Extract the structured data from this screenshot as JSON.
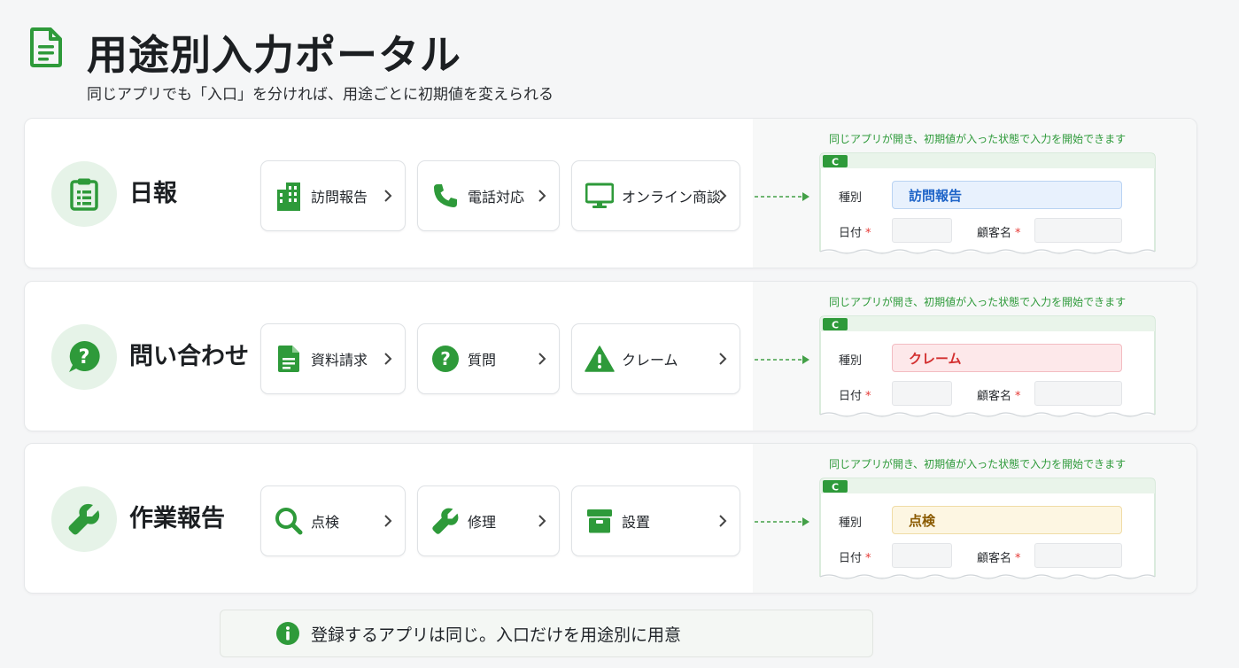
{
  "header": {
    "title": "用途別入力ポータル",
    "subtitle": "同じアプリでも「入口」を分ければ、用途ごとに初期値を変えられる",
    "icon": "document-icon"
  },
  "colors": {
    "accent_green": "#2e9a3a",
    "blue_fill": "#e8f1fd",
    "blue_text": "#1e64c8",
    "red_fill": "#fde8ea",
    "red_text": "#d32f2f",
    "yellow_fill": "#fdf6e2",
    "yellow_text": "#8a5a00"
  },
  "categories": [
    {
      "name": "日報",
      "icon": "clipboard-icon",
      "entries": [
        {
          "label": "訪問報告",
          "icon": "building-icon"
        },
        {
          "label": "電話対応",
          "icon": "phone-icon"
        },
        {
          "label": "オンライン商談",
          "icon": "monitor-icon"
        }
      ],
      "preview": {
        "caption": "同じアプリが開き、初期値が入った状態で入力を開始できます",
        "type_label": "種別",
        "type_value": "訪問報告",
        "date_label": "日付",
        "customer_label": "顧客名",
        "required_mark": "*"
      }
    },
    {
      "name": "問い合わせ",
      "icon": "question-bubble-icon",
      "entries": [
        {
          "label": "資料請求",
          "icon": "document-icon"
        },
        {
          "label": "質問",
          "icon": "question-icon"
        },
        {
          "label": "クレーム",
          "icon": "warning-icon"
        }
      ],
      "preview": {
        "caption": "同じアプリが開き、初期値が入った状態で入力を開始できます",
        "type_label": "種別",
        "type_value": "クレーム",
        "date_label": "日付",
        "customer_label": "顧客名",
        "required_mark": "*"
      }
    },
    {
      "name": "作業報告",
      "icon": "wrench-icon",
      "entries": [
        {
          "label": "点検",
          "icon": "search-icon"
        },
        {
          "label": "修理",
          "icon": "wrench-icon"
        },
        {
          "label": "設置",
          "icon": "box-icon"
        }
      ],
      "preview": {
        "caption": "同じアプリが開き、初期値が入った状態で入力を開始できます",
        "type_label": "種別",
        "type_value": "点検",
        "date_label": "日付",
        "customer_label": "顧客名",
        "required_mark": "*"
      }
    }
  ],
  "footer": {
    "note": "登録するアプリは同じ。入口だけを用途別に用意",
    "icon": "info-icon"
  }
}
